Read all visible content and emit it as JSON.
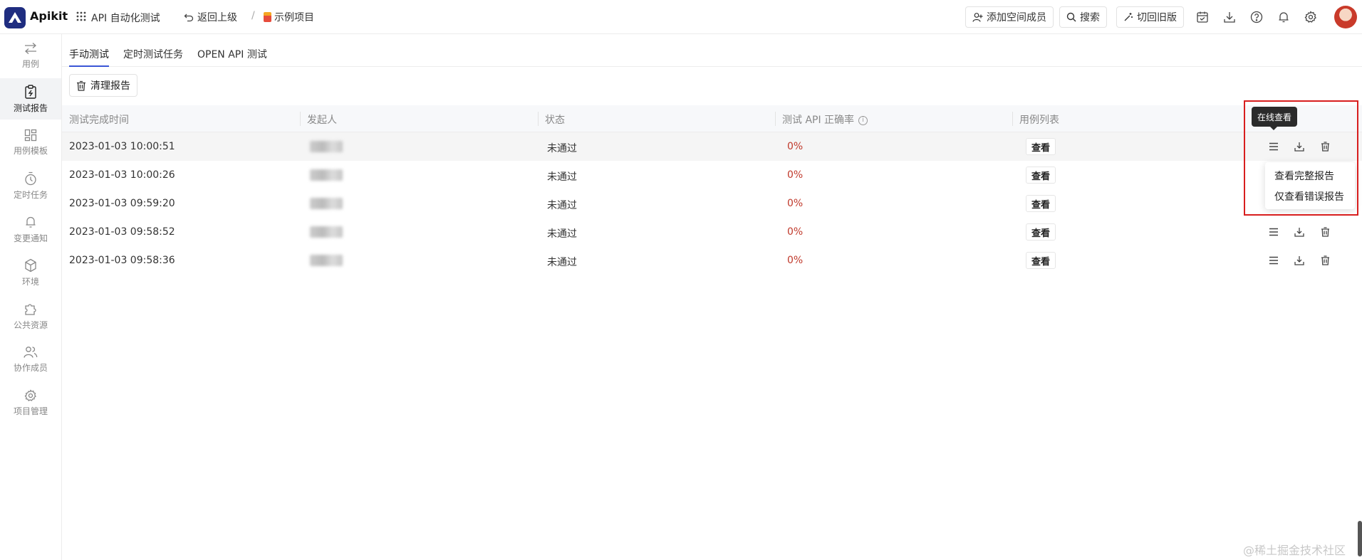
{
  "app": {
    "name": "Apikit",
    "module": "API 自动化测试"
  },
  "breadcrumb": {
    "back": "返回上级",
    "separator": "/",
    "project": "示例项目"
  },
  "toolbar": {
    "add_member": "添加空间成员",
    "search": "搜索",
    "switch_old": "切回旧版"
  },
  "sidebar": {
    "items": [
      {
        "label": "用例",
        "icon": "swap-icon"
      },
      {
        "label": "测试报告",
        "icon": "report-icon",
        "active": true
      },
      {
        "label": "用例模板",
        "icon": "template-icon"
      },
      {
        "label": "定时任务",
        "icon": "timer-icon"
      },
      {
        "label": "变更通知",
        "icon": "bell-icon"
      },
      {
        "label": "环境",
        "icon": "cube-icon"
      },
      {
        "label": "公共资源",
        "icon": "puzzle-icon"
      },
      {
        "label": "协作成员",
        "icon": "users-icon"
      },
      {
        "label": "项目管理",
        "icon": "gear-icon"
      }
    ]
  },
  "tabs": [
    {
      "label": "手动测试",
      "active": true
    },
    {
      "label": "定时测试任务"
    },
    {
      "label": "OPEN API 测试"
    }
  ],
  "clean_button": "清理报告",
  "table": {
    "headers": [
      "测试完成时间",
      "发起人",
      "状态",
      "测试 API 正确率",
      "用例列表"
    ],
    "view_label": "查看",
    "rows": [
      {
        "time": "2023-01-03 10:00:51",
        "status": "未通过",
        "rate": "0%"
      },
      {
        "time": "2023-01-03 10:00:26",
        "status": "未通过",
        "rate": "0%"
      },
      {
        "time": "2023-01-03 09:59:20",
        "status": "未通过",
        "rate": "0%"
      },
      {
        "time": "2023-01-03 09:58:52",
        "status": "未通过",
        "rate": "0%"
      },
      {
        "time": "2023-01-03 09:58:36",
        "status": "未通过",
        "rate": "0%"
      }
    ]
  },
  "tooltip": "在线查看",
  "dropdown": {
    "items": [
      "查看完整报告",
      "仅查看错误报告"
    ]
  },
  "watermark": "@稀土掘金技术社区",
  "colors": {
    "accent": "#3a55d6",
    "brand": "#1f2d80",
    "fail_rate": "#c0392b",
    "highlight": "#d81e1e"
  }
}
